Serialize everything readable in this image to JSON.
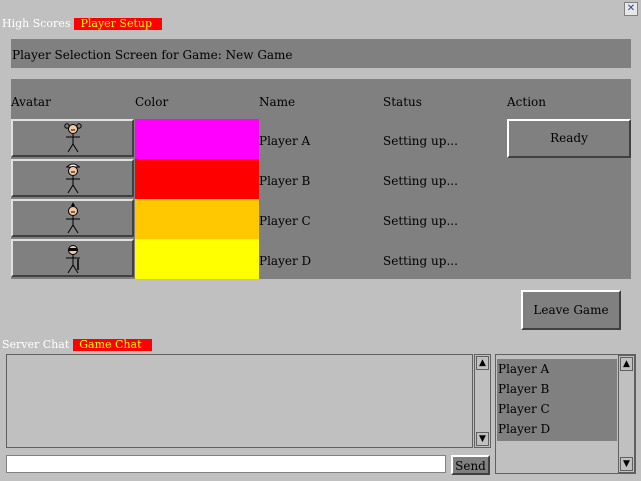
{
  "top_tabs": {
    "high_scores": "High Scores",
    "player_setup": "Player Setup"
  },
  "close_button": "✕",
  "screen_title": "Player Selection Screen for Game: New Game",
  "columns": {
    "avatar": "Avatar",
    "color": "Color",
    "name": "Name",
    "status": "Status",
    "action": "Action"
  },
  "players": [
    {
      "name": "Player A",
      "status": "Setting up...",
      "color": "#ff00ff",
      "avatar": "stick-figure-pigtails"
    },
    {
      "name": "Player B",
      "status": "Setting up...",
      "color": "#ff0000",
      "avatar": "stick-figure-cap"
    },
    {
      "name": "Player C",
      "status": "Setting up...",
      "color": "#ffc800",
      "avatar": "stick-figure-topknot"
    },
    {
      "name": "Player D",
      "status": "Setting up...",
      "color": "#ffff00",
      "avatar": "stick-figure-ninja"
    }
  ],
  "ready_button": "Ready",
  "leave_button": "Leave Game",
  "chat_tabs": {
    "server_chat": "Server Chat",
    "game_chat": "Game Chat"
  },
  "chat": {
    "input_value": "",
    "send_label": "Send"
  },
  "player_list": [
    "Player A",
    "Player B",
    "Player C",
    "Player D"
  ]
}
